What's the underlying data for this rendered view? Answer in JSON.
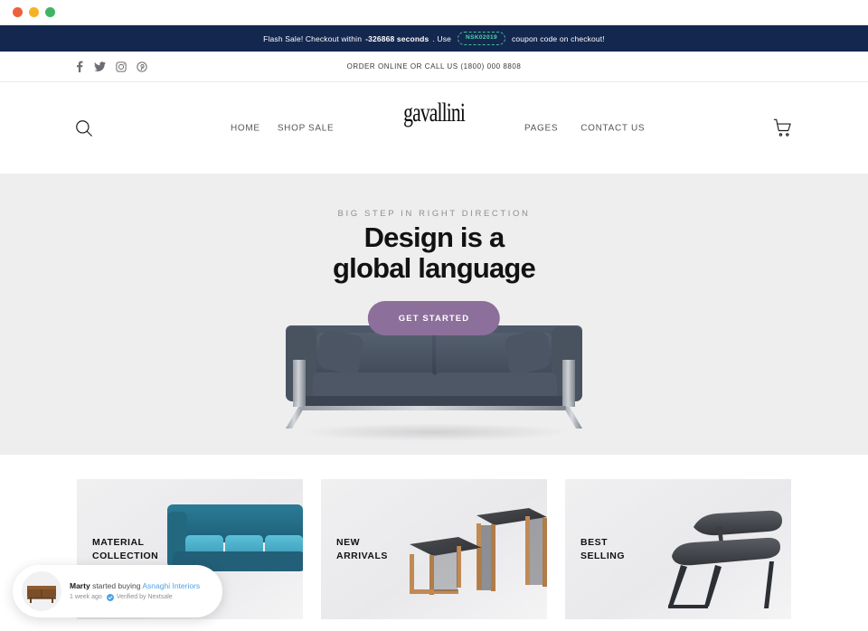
{
  "browser": {
    "traffic_lights": [
      "close",
      "minimize",
      "maximize"
    ]
  },
  "announcement": {
    "prefix": "Flash Sale! Checkout within",
    "countdown": "-326868 seconds",
    "middle": ". Use",
    "coupon_code": "NSK02019",
    "suffix": "coupon code on checkout!",
    "bg_color": "#14274f",
    "coupon_color": "#4fd6ae"
  },
  "topbar": {
    "socials": [
      {
        "name": "facebook-icon",
        "label": "Facebook"
      },
      {
        "name": "twitter-icon",
        "label": "Twitter"
      },
      {
        "name": "instagram-icon",
        "label": "Instagram"
      },
      {
        "name": "pinterest-icon",
        "label": "Pinterest"
      }
    ],
    "phone_text": "ORDER ONLINE OR CALL US (1800) 000 8808"
  },
  "header": {
    "search_icon": "search-icon",
    "cart_icon": "cart-icon",
    "brand": "gavallini",
    "nav_left": [
      {
        "label": "HOME"
      },
      {
        "label": "SHOP"
      },
      {
        "label": "SALE"
      }
    ],
    "nav_right": [
      {
        "label": "PAGES"
      },
      {
        "label": "CONTACT US"
      }
    ]
  },
  "hero": {
    "eyebrow": "BIG STEP IN RIGHT DIRECTION",
    "title_line1": "Design is a",
    "title_line2": "global language",
    "cta_label": "GET STARTED",
    "cta_color": "#8c6f9a",
    "bg_color": "#eeeeef",
    "product_image": "blue-grey-sofa"
  },
  "cards": [
    {
      "label": "MATERIAL\nCOLLECTION",
      "art": "teal-sofa"
    },
    {
      "label": "NEW\nARRIVALS",
      "art": "wood-side-tables"
    },
    {
      "label": "BEST\nSELLING",
      "art": "dark-bench"
    }
  ],
  "notification": {
    "thumb": "sideboard-thumbnail",
    "name": "Marty",
    "action": "started buying",
    "product": "Asnaghi Interiors",
    "time": "1 week ago",
    "verified": "Verified by Nextsale",
    "verified_icon": "check-badge-icon",
    "link_color": "#4da3e8"
  }
}
